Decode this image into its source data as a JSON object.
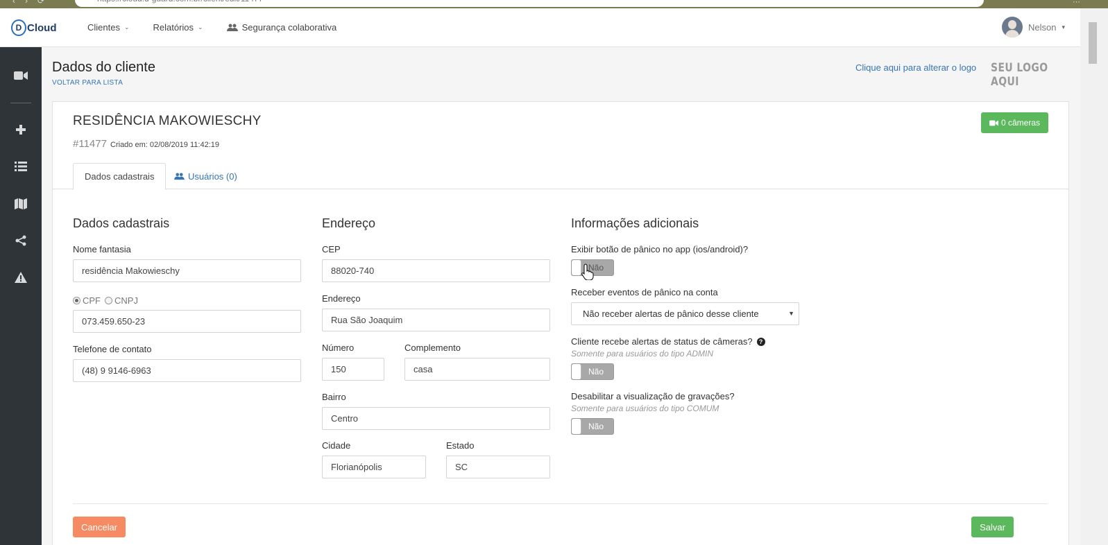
{
  "browser": {
    "url": "https://cloud.d-guard.com.br/client/edit/11477"
  },
  "navbar": {
    "brand": "Cloud",
    "brand_letter": "D",
    "menu": [
      {
        "label": "Clientes"
      },
      {
        "label": "Relatórios"
      },
      {
        "label": "Segurança colaborativa"
      }
    ],
    "user_name": "Nelson"
  },
  "page": {
    "title": "Dados do cliente",
    "back_link": "VOLTAR PARA LISTA",
    "change_logo_link": "Clique aqui para alterar o logo",
    "logo_placeholder": "SEU LOGO AQUI"
  },
  "client": {
    "name": "RESIDÊNCIA MAKOWIESCHY",
    "id": "#11477",
    "created": "Criado em: 02/08/2019 11:42:19",
    "cameras_button": "0 câmeras"
  },
  "tabs": [
    {
      "label": "Dados cadastrais",
      "active": true
    },
    {
      "label": "Usuários (0)",
      "active": false
    }
  ],
  "registration": {
    "title": "Dados cadastrais",
    "trade_name_label": "Nome fantasia",
    "trade_name_value": "residência Makowieschy",
    "doc_type_cpf": "CPF",
    "doc_type_cnpj": "CNPJ",
    "doc_value": "073.459.650-23",
    "phone_label": "Telefone de contato",
    "phone_value": "(48) 9 9146-6963"
  },
  "address": {
    "title": "Endereço",
    "cep_label": "CEP",
    "cep_value": "88020-740",
    "street_label": "Endereço",
    "street_value": "Rua São Joaquim",
    "number_label": "Número",
    "number_value": "150",
    "complement_label": "Complemento",
    "complement_value": "casa",
    "district_label": "Bairro",
    "district_value": "Centro",
    "city_label": "Cidade",
    "city_value": "Florianópolis",
    "state_label": "Estado",
    "state_value": "SC"
  },
  "additional": {
    "title": "Informações adicionais",
    "panic_button_label": "Exibir botão de pânico no app (ios/android)?",
    "panic_button_value": "Não",
    "panic_events_label": "Receber eventos de pânico na conta",
    "panic_events_value": "Não receber alertas de pânico desse cliente",
    "camera_alerts_label": "Cliente recebe alertas de status de câmeras?",
    "camera_alerts_hint": "Somente para usuários do tipo ADMIN",
    "camera_alerts_value": "Não",
    "disable_recordings_label": "Desabilitar a visualização de gravações?",
    "disable_recordings_hint": "Somente para usuários do tipo COMUM",
    "disable_recordings_value": "Não"
  },
  "actions": {
    "cancel": "Cancelar",
    "save": "Salvar"
  },
  "colors": {
    "sidebar": "#2f3439",
    "link": "#3575b5",
    "success": "#5cb85c",
    "cancel": "#f58a63"
  }
}
